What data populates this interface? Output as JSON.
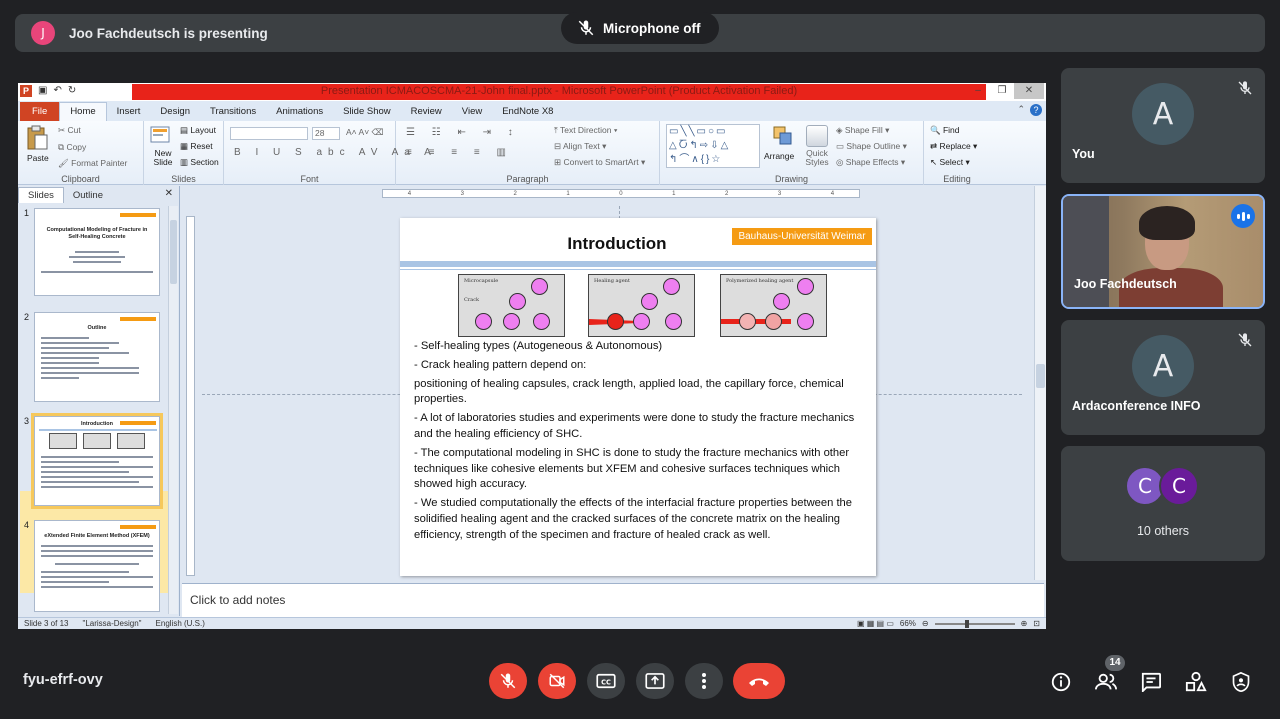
{
  "presenting": {
    "avatar_letter": "J",
    "text": "Joo Fachdeutsch is presenting"
  },
  "mic_toast": {
    "text": "Microphone off"
  },
  "ppt": {
    "window_title": "Presentation ICMACOSCMA-21-John final.pptx  -  Microsoft PowerPoint (Product Activation Failed)",
    "logo": "P",
    "tabs": [
      "File",
      "Home",
      "Insert",
      "Design",
      "Transitions",
      "Animations",
      "Slide Show",
      "Review",
      "View",
      "EndNote X8"
    ],
    "active_tab": "Home",
    "ribbon": {
      "clipboard": {
        "label": "Clipboard",
        "paste": "Paste",
        "cut": "Cut",
        "copy": "Copy",
        "format_painter": "Format Painter"
      },
      "slides": {
        "label": "Slides",
        "new_slide": "New Slide",
        "layout": "Layout",
        "reset": "Reset",
        "section": "Section"
      },
      "font": {
        "label": "Font",
        "size": "28"
      },
      "paragraph": {
        "label": "Paragraph",
        "text_direction": "Text Direction",
        "align_text": "Align Text",
        "smartart": "Convert to SmartArt"
      },
      "drawing": {
        "label": "Drawing",
        "arrange": "Arrange",
        "quick_styles": "Quick Styles",
        "shape_fill": "Shape Fill",
        "shape_outline": "Shape Outline",
        "shape_effects": "Shape Effects"
      },
      "editing": {
        "label": "Editing",
        "find": "Find",
        "replace": "Replace",
        "select": "Select"
      }
    },
    "pane_tabs": {
      "slides": "Slides",
      "outline": "Outline"
    },
    "thumbs": [
      {
        "num": "1",
        "title": "Computational Modeling of Fracture in Self-Healing Concrete"
      },
      {
        "num": "2",
        "title": "Outline"
      },
      {
        "num": "3",
        "title": "Introduction"
      },
      {
        "num": "4",
        "title": "eXtended Finite Element Method (XFEM)"
      }
    ],
    "slide": {
      "title": "Introduction",
      "badge": "Bauhaus-Universität Weimar",
      "fig_labels": [
        "Microcapsule",
        "Crack",
        "Healing agent",
        "Polymerized healing agent"
      ],
      "bullets": [
        "- Self-healing types (Autogeneous & Autonomous)",
        "- Crack healing pattern depend on:",
        " positioning of healing capsules, crack length, applied load, the capillary force, chemical properties.",
        "- A lot of laboratories studies and experiments were done to study the fracture mechanics and the healing efficiency of SHC.",
        "- The computational modeling in SHC is done to study the fracture mechanics with other techniques like cohesive elements but XFEM and cohesive surfaces techniques which showed high accuracy.",
        "- We studied computationally the effects of the interfacial fracture properties between the solidified healing agent and the cracked surfaces of the concrete matrix on the healing efficiency, strength of the specimen and fracture of healed crack as well."
      ]
    },
    "notes_placeholder": "Click to add notes",
    "status": {
      "slide": "Slide 3 of 13",
      "theme": "\"Larissa-Design\"",
      "language": "English (U.S.)",
      "zoom": "66%"
    }
  },
  "participants": [
    {
      "name": "You",
      "letter": "A",
      "muted": true
    },
    {
      "name": "Joo Fachdeutsch",
      "video": true,
      "speaking": true
    },
    {
      "name": "Ardaconference INFO",
      "letter": "A",
      "muted": true
    },
    {
      "name": "10 others",
      "letters": [
        "C",
        "C"
      ],
      "colors": [
        "#7e57c2",
        "#6a1b9a"
      ]
    }
  ],
  "meeting_code": "fyu-efrf-ovy",
  "people_count": "14",
  "colors": {
    "end_call": "#ea4335",
    "avatar_bg": "#455a64",
    "accent": "#8ab4f8"
  },
  "icons": [
    "mic-off-icon",
    "camera-off-icon",
    "captions-icon",
    "present-icon",
    "more-vert-icon",
    "end-call-icon",
    "info-icon",
    "people-icon",
    "chat-icon",
    "activities-icon",
    "shield-icon"
  ]
}
